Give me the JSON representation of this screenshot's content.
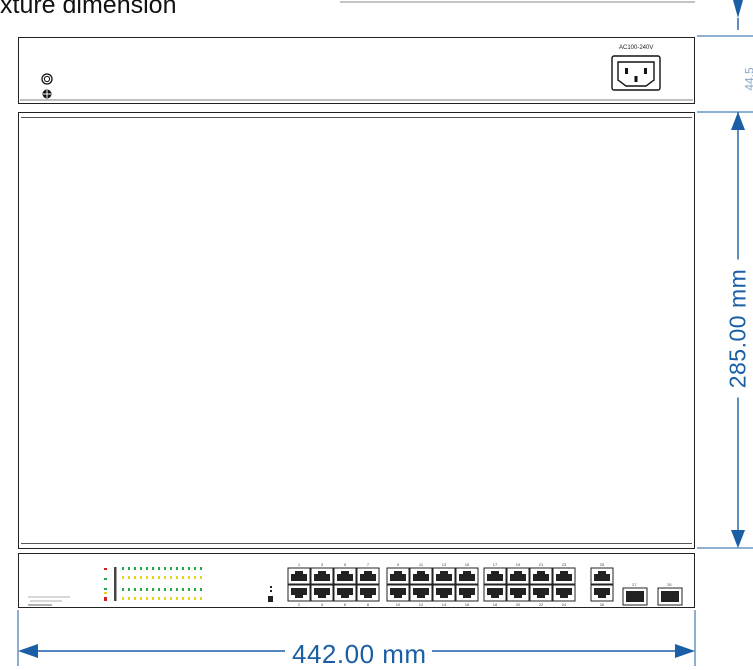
{
  "heading": "xture  dimension",
  "rear_panel": {
    "power_label": "AC100-240V",
    "power_socket_icon": "iec-c14-socket-icon",
    "ground_icon": "ground-terminal-icon"
  },
  "dimensions": {
    "width": "442.00 mm",
    "height": "285.00 mm",
    "depth": "44.5"
  },
  "front_panel": {
    "port_top_numbers": [
      "1",
      "3",
      "5",
      "7",
      "9",
      "11",
      "13",
      "15",
      "17",
      "19",
      "21",
      "23",
      "25"
    ],
    "port_bottom_numbers": [
      "2",
      "4",
      "6",
      "8",
      "10",
      "12",
      "14",
      "16",
      "18",
      "20",
      "22",
      "24",
      "26"
    ],
    "sfp_numbers": [
      "27",
      "28"
    ]
  },
  "colors": {
    "dimension_blue": "#1a5fa5",
    "outline": "#222222",
    "led_green": "#22aa44",
    "led_yellow": "#e5d21a",
    "led_red": "#d02020"
  }
}
